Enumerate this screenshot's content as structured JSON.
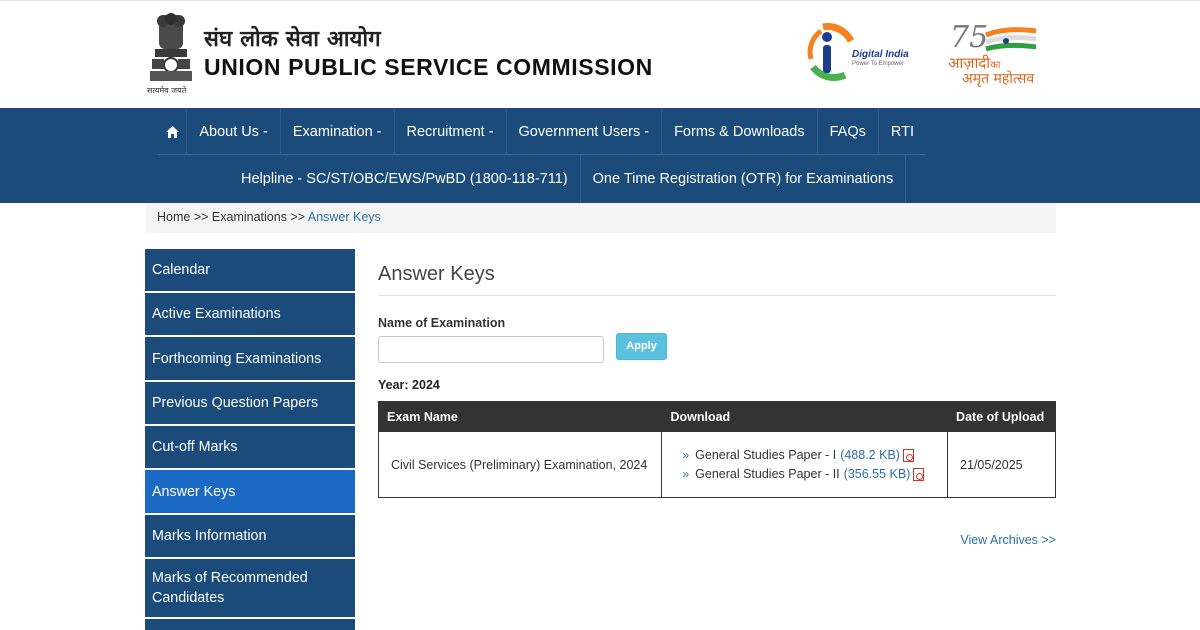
{
  "header": {
    "emblem_motto": "सत्यमेव जयते",
    "org_name_hindi": "संघ लोक सेवा आयोग",
    "org_name_english": "UNION PUBLIC SERVICE COMMISSION",
    "digital_india_title": "Digital India",
    "digital_india_tagline": "Power To Empower",
    "azadi_line1": "आज़ादी",
    "azadi_small": "का",
    "azadi_line2": "अमृत महोत्सव",
    "azadi_number": "75"
  },
  "nav": {
    "home_icon": "home-icon",
    "row1": [
      {
        "label": "About Us -"
      },
      {
        "label": "Examination -"
      },
      {
        "label": "Recruitment -"
      },
      {
        "label": "Government Users -"
      },
      {
        "label": "Forms & Downloads"
      },
      {
        "label": "FAQs"
      },
      {
        "label": "RTI"
      }
    ],
    "row2": [
      {
        "label": "Helpline - SC/ST/OBC/EWS/PwBD (1800-118-711)"
      },
      {
        "label": "One Time Registration (OTR) for Examinations"
      }
    ]
  },
  "breadcrumb": {
    "home": "Home",
    "sep1": ">>",
    "examinations": "Examinations",
    "sep2": ">>",
    "current": "Answer Keys"
  },
  "sidebar": {
    "items": [
      {
        "label": "Calendar"
      },
      {
        "label": "Active Examinations"
      },
      {
        "label": "Forthcoming Examinations"
      },
      {
        "label": "Previous Question Papers"
      },
      {
        "label": "Cut-off Marks"
      },
      {
        "label": "Answer Keys",
        "active": true
      },
      {
        "label": "Marks Information"
      },
      {
        "label": "Marks of Recommended Candidates"
      }
    ]
  },
  "main": {
    "title": "Answer Keys",
    "filter_label": "Name of Examination",
    "filter_value": "",
    "apply_label": "Apply",
    "year_label": "Year: 2024",
    "table": {
      "headers": [
        "Exam Name",
        "Download",
        "Date of Upload"
      ],
      "rows": [
        {
          "exam_name": "Civil Services (Preliminary) Examination, 2024",
          "downloads": [
            {
              "name": "General Studies Paper - I",
              "size": "(488.2 KB)"
            },
            {
              "name": "General Studies Paper - II",
              "size": "(356.55 KB)"
            }
          ],
          "date": "21/05/2025"
        }
      ]
    },
    "view_archives": "View Archives >>"
  },
  "colors": {
    "nav_bg": "#1a4b7a",
    "sidebar_active": "#1a69c5",
    "link": "#2a6ea8",
    "apply_button": "#5bc0de",
    "table_header": "#333333"
  }
}
